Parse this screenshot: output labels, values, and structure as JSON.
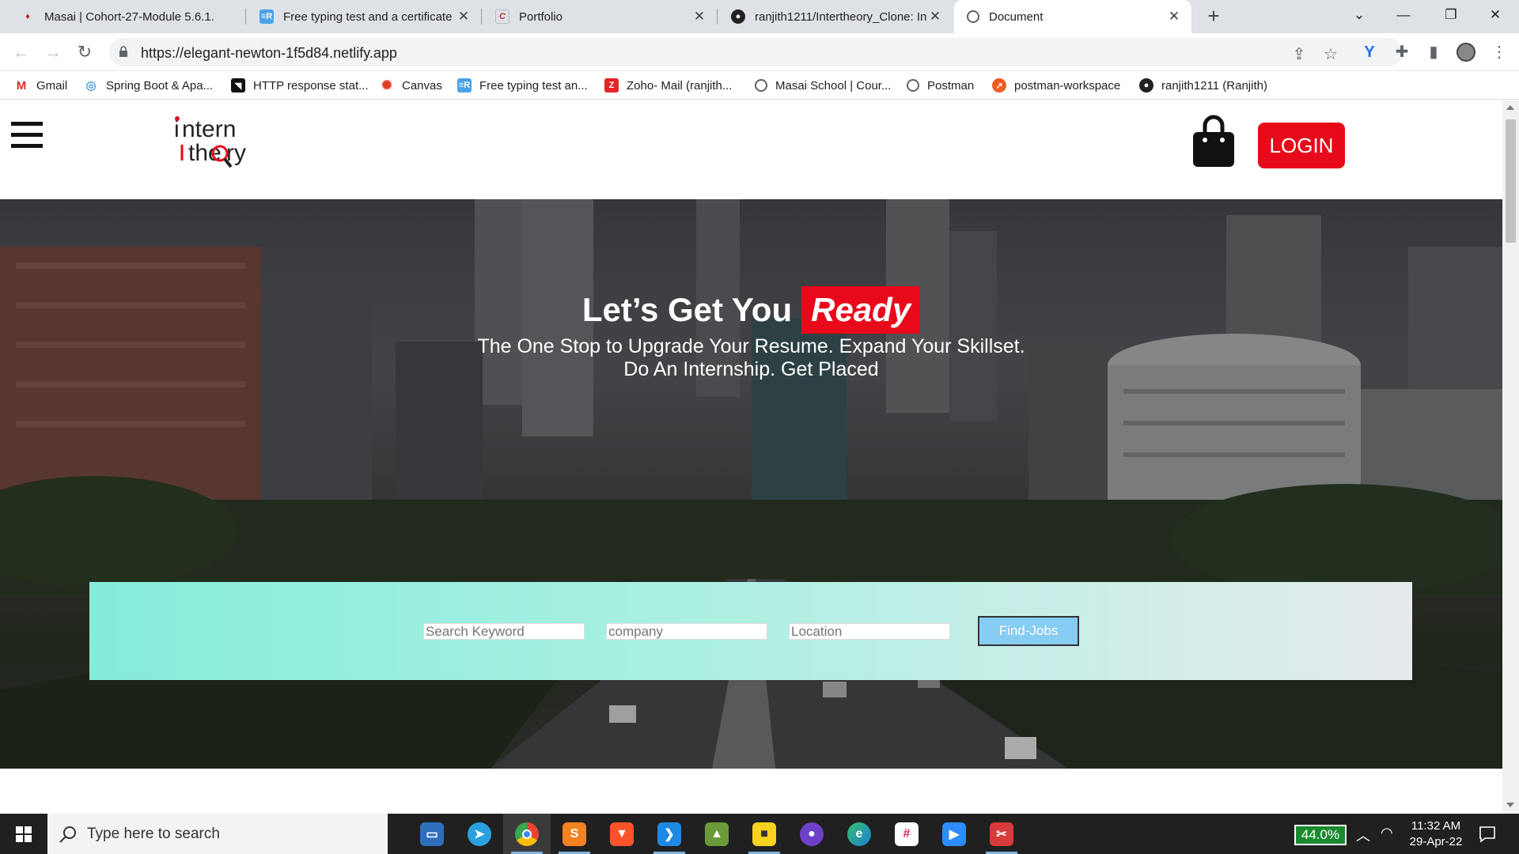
{
  "browser": {
    "tabs": [
      {
        "title": "Masai | Cohort-27-Module 5.6.1.",
        "favicon": "masai-favicon",
        "active": false
      },
      {
        "title": "Free typing test and a certificate",
        "favicon": "typing-favicon",
        "active": false
      },
      {
        "title": "Portfolio",
        "favicon": "portfolio-favicon",
        "active": false
      },
      {
        "title": "ranjith1211/Intertheory_Clone: In",
        "favicon": "github-favicon",
        "active": false
      },
      {
        "title": "Document",
        "favicon": "globe-favicon",
        "active": true
      }
    ],
    "url": "https://elegant-newton-1f5d84.netlify.app",
    "bookmarks": [
      {
        "label": "Gmail",
        "icon": "gmail-icon"
      },
      {
        "label": "Spring Boot & Apa...",
        "icon": "spring-icon"
      },
      {
        "label": "HTTP response stat...",
        "icon": "http-icon"
      },
      {
        "label": "Canvas",
        "icon": "canvas-icon"
      },
      {
        "label": "Free typing test an...",
        "icon": "typing-icon"
      },
      {
        "label": "Zoho- Mail (ranjith...",
        "icon": "zoho-icon"
      },
      {
        "label": "Masai School | Cour...",
        "icon": "globe-icon"
      },
      {
        "label": "Postman",
        "icon": "globe-icon"
      },
      {
        "label": "postman-workspace",
        "icon": "postman-icon"
      },
      {
        "label": "ranjith1211 (Ranjith)",
        "icon": "github-icon"
      }
    ]
  },
  "site": {
    "login_label": "LOGIN",
    "headline_prefix": "Let’s Get You",
    "headline_highlight": "Ready",
    "subtitle_line1": "The One Stop to Upgrade Your Resume. Expand Your Skillset.",
    "subtitle_line2": "Do An Internship. Get Placed",
    "search": {
      "keyword_placeholder": "Search Keyword",
      "company_placeholder": "company",
      "location_placeholder": "Location",
      "button_label": "Find-Jobs"
    },
    "colors": {
      "brand_red": "#e8091b",
      "search_gradient_start": "#85ecd9",
      "button_blue": "#87ccf3"
    }
  },
  "taskbar": {
    "search_placeholder": "Type here to search",
    "battery": "44.0%",
    "time": "11:32 AM",
    "date": "29-Apr-22"
  }
}
